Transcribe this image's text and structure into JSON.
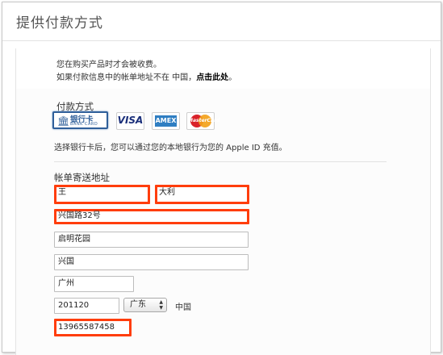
{
  "header": {
    "title": "提供付款方式"
  },
  "info": {
    "line1": "您在购买产品时才会被收费。",
    "line2_prefix": "如果付款信息中的帐单地址不在 中国，",
    "line2_link": "点击此处",
    "line2_suffix": "。"
  },
  "payment": {
    "label": "付款方式",
    "cards": {
      "bank": {
        "name": "银行卡",
        "sub": "BANK CARD",
        "icon": "bank-card-icon"
      },
      "visa": {
        "name": "VISA",
        "icon": "visa-icon"
      },
      "amex": {
        "name": "AMEX",
        "icon": "amex-icon"
      },
      "mastercard": {
        "name": "MasterCard",
        "icon": "mastercard-icon"
      }
    },
    "note": "选择银行卡后，您可以通过您的本地银行为您的 Apple ID 充值。"
  },
  "billing": {
    "label": "帐单寄送地址",
    "last_name": "王",
    "first_name": "大利",
    "street1": "兴国路32号",
    "street2": "启明花园",
    "street3": "兴国",
    "city": "广州",
    "postcode": "201120",
    "province": "广东",
    "country": "中国",
    "phone": "13965587458"
  },
  "colors": {
    "highlight": "#ff3d0c",
    "selected_card": "#2f5f9a"
  }
}
